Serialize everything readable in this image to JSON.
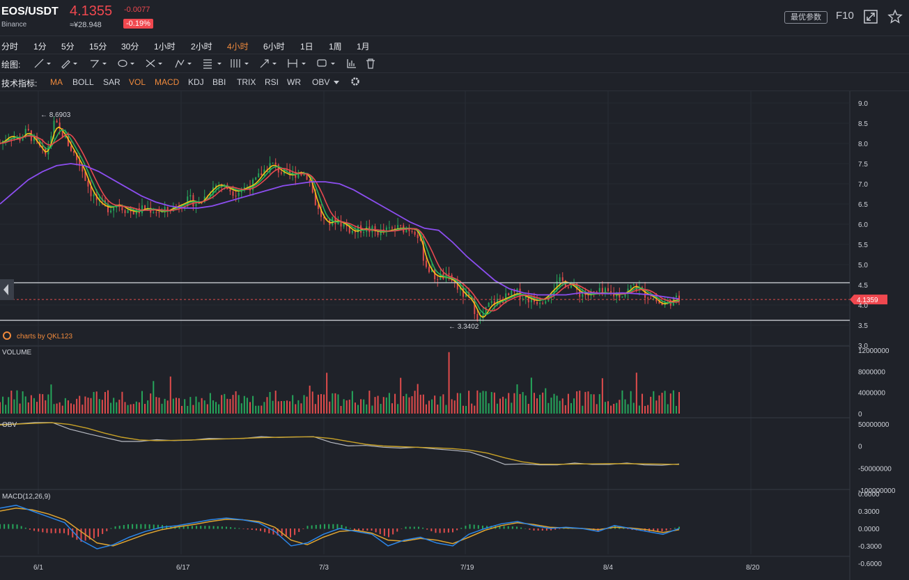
{
  "header": {
    "pair": "EOS/USDT",
    "exchange": "Binance",
    "price": "4.1355",
    "cny_price": "≈¥28.948",
    "change": "-0.0077",
    "change_pct": "-0.19%",
    "best_params_label": "最优参数",
    "f10_label": "F10",
    "icons": [
      "fullscreen-icon",
      "star-icon"
    ]
  },
  "timeframes": [
    {
      "label": "分时",
      "active": false
    },
    {
      "label": "1分",
      "active": false
    },
    {
      "label": "5分",
      "active": false
    },
    {
      "label": "15分",
      "active": false
    },
    {
      "label": "30分",
      "active": false
    },
    {
      "label": "1小时",
      "active": false
    },
    {
      "label": "2小时",
      "active": false
    },
    {
      "label": "4小时",
      "active": true
    },
    {
      "label": "6小时",
      "active": false
    },
    {
      "label": "1日",
      "active": false
    },
    {
      "label": "1周",
      "active": false
    },
    {
      "label": "1月",
      "active": false
    }
  ],
  "drawing": {
    "label": "绘图:",
    "tools": [
      "line-tool-icon",
      "pen-tool-icon",
      "polyline-tool-icon",
      "ellipse-tool-icon",
      "cross-tool-icon",
      "pattern-tool-icon",
      "fib-tool-icon",
      "gann-tool-icon",
      "arrow-tool-icon",
      "measure-tool-icon",
      "note-tool-icon",
      "bar-chart-icon",
      "trash-icon"
    ]
  },
  "indicators": {
    "label": "技术指标:",
    "items": [
      {
        "label": "MA",
        "active": true
      },
      {
        "label": "BOLL",
        "active": false
      },
      {
        "label": "SAR",
        "active": false
      },
      {
        "label": "VOL",
        "active": true
      },
      {
        "label": "MACD",
        "active": true
      },
      {
        "label": "KDJ",
        "active": false
      },
      {
        "label": "BBI",
        "active": false
      },
      {
        "label": "TRIX",
        "active": false
      },
      {
        "label": "RSI",
        "active": false
      },
      {
        "label": "WR",
        "active": false
      },
      {
        "label": "OBV",
        "active": false
      }
    ]
  },
  "chart_data": {
    "type": "line",
    "x_dates": [
      "6/1",
      "6/17",
      "7/3",
      "7/19",
      "8/4",
      "8/20"
    ],
    "price_axis": {
      "ticks": [
        "9.0",
        "8.5",
        "8.0",
        "7.5",
        "7.0",
        "6.5",
        "6.0",
        "5.5",
        "5.0",
        "4.5",
        "4.0",
        "3.5",
        "3.0"
      ],
      "ylim": [
        3.0,
        9.0
      ]
    },
    "high_label": "← 8.6903",
    "low_label": "← 3.3402",
    "current_price_tag": "4.1359",
    "current_price": 4.1359,
    "horizontal_lines": [
      4.55,
      3.62
    ],
    "watermark": "charts by QKL123",
    "price_series": [
      8.0,
      8.2,
      8.1,
      8.3,
      8.0,
      7.7,
      8.5,
      8.2,
      7.8,
      7.4,
      6.8,
      6.5,
      6.4,
      6.5,
      6.35,
      6.3,
      6.4,
      6.35,
      6.3,
      6.4,
      6.5,
      6.6,
      6.5,
      6.8,
      7.0,
      6.9,
      6.8,
      6.9,
      7.0,
      7.3,
      7.5,
      7.3,
      7.2,
      7.3,
      7.2,
      6.4,
      6.0,
      6.1,
      6.0,
      5.8,
      5.9,
      5.85,
      5.8,
      5.85,
      5.9,
      5.9,
      5.85,
      5.0,
      4.7,
      4.7,
      4.6,
      4.3,
      4.1,
      3.6,
      4.0,
      4.1,
      4.2,
      4.3,
      4.2,
      4.1,
      4.15,
      4.4,
      4.6,
      4.5,
      4.3,
      4.25,
      4.3,
      4.3,
      4.25,
      4.3,
      4.5,
      4.3,
      4.2,
      4.0,
      4.1,
      4.1359
    ],
    "ma_slow": [
      6.5,
      6.8,
      7.1,
      7.3,
      7.45,
      7.5,
      7.45,
      7.3,
      7.1,
      6.9,
      6.7,
      6.55,
      6.45,
      6.4,
      6.4,
      6.45,
      6.55,
      6.65,
      6.75,
      6.85,
      6.95,
      7.0,
      7.05,
      7.05,
      7.0,
      6.85,
      6.65,
      6.45,
      6.25,
      6.05,
      5.9,
      5.85,
      5.55,
      5.2,
      4.9,
      4.6,
      4.4,
      4.3,
      4.25,
      4.25,
      4.25,
      4.3,
      4.3,
      4.28,
      4.3,
      4.28,
      4.25,
      4.2,
      4.15
    ],
    "volume_axis": {
      "title": "VOLUME",
      "ticks": [
        "12000000",
        "8000000",
        "4000000",
        "0"
      ]
    },
    "obv_axis": {
      "title": "OBV",
      "ticks": [
        "50000000",
        "0",
        "-50000000",
        "-100000000"
      ]
    },
    "obv_series": [
      48,
      52,
      55,
      52,
      40,
      30,
      18,
      12,
      12,
      13,
      14,
      15,
      16,
      18,
      19,
      20,
      21,
      22,
      20,
      10,
      2,
      0,
      -1,
      -3,
      -4,
      -5,
      -8,
      -15,
      -25,
      -40,
      -42,
      -41,
      -41,
      -40,
      -40,
      -40,
      -40,
      -41,
      -42,
      -42
    ],
    "macd_axis": {
      "title": "MACD(12,26,9)",
      "ticks": [
        "0.6000",
        "0.3000",
        "0.0000",
        "-0.3000",
        "-0.6000"
      ]
    },
    "macd_dif": [
      0.35,
      0.4,
      0.3,
      0.2,
      0.1,
      -0.2,
      -0.35,
      -0.28,
      -0.15,
      -0.05,
      0.02,
      0.05,
      0.1,
      0.15,
      0.18,
      0.15,
      0.1,
      -0.05,
      -0.3,
      -0.25,
      -0.1,
      0.0,
      -0.05,
      -0.1,
      -0.3,
      -0.2,
      -0.15,
      -0.25,
      -0.3,
      -0.1,
      0.0,
      0.08,
      0.12,
      0.05,
      0.0,
      0.02,
      0.0,
      -0.05,
      0.05,
      0.0,
      -0.05,
      -0.1,
      0.0
    ],
    "macd_dea": [
      0.3,
      0.35,
      0.32,
      0.25,
      0.15,
      -0.05,
      -0.25,
      -0.3,
      -0.2,
      -0.1,
      -0.02,
      0.03,
      0.07,
      0.12,
      0.16,
      0.15,
      0.12,
      0.02,
      -0.2,
      -0.28,
      -0.15,
      -0.05,
      -0.03,
      -0.08,
      -0.2,
      -0.22,
      -0.17,
      -0.2,
      -0.26,
      -0.15,
      -0.03,
      0.05,
      0.1,
      0.07,
      0.02,
      0.01,
      0.0,
      -0.02,
      0.02,
      0.01,
      -0.02,
      -0.07,
      -0.02
    ],
    "colors": {
      "up": "#26a65b",
      "down": "#e04c4c",
      "ma5": "#f5c518",
      "ma10": "#27b35a",
      "ma20": "#e84a4f",
      "ma60": "#8c4ef0",
      "obv": "#b9bcc4",
      "obv_ma": "#c9a227",
      "dif": "#2c86e8",
      "dea": "#e0a531"
    }
  }
}
